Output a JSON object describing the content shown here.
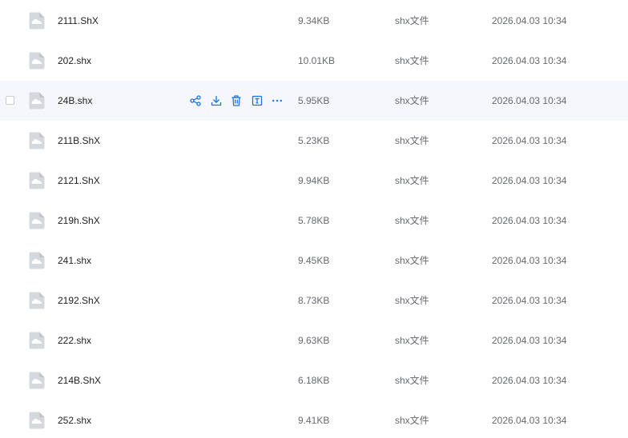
{
  "colors": {
    "accent": "#1a73e8",
    "hover_row": "#f5f7fa",
    "icon_gray": "#d5d8dd"
  },
  "hover_actions": [
    {
      "icon": "share-icon"
    },
    {
      "icon": "download-icon"
    },
    {
      "icon": "delete-icon"
    },
    {
      "icon": "rename-icon"
    },
    {
      "icon": "more-icon"
    }
  ],
  "files": [
    {
      "name": "2111.ShX",
      "size": "9.34KB",
      "type": "shx文件",
      "modified": "2026.04.03 10:34"
    },
    {
      "name": "202.shx",
      "size": "10.01KB",
      "type": "shx文件",
      "modified": "2026.04.03 10:34"
    },
    {
      "name": "24B.shx",
      "size": "5.95KB",
      "type": "shx文件",
      "modified": "2026.04.03 10:34"
    },
    {
      "name": "211B.ShX",
      "size": "5.23KB",
      "type": "shx文件",
      "modified": "2026.04.03 10:34"
    },
    {
      "name": "2121.ShX",
      "size": "9.94KB",
      "type": "shx文件",
      "modified": "2026.04.03 10:34"
    },
    {
      "name": "219h.ShX",
      "size": "5.78KB",
      "type": "shx文件",
      "modified": "2026.04.03 10:34"
    },
    {
      "name": "241.shx",
      "size": "9.45KB",
      "type": "shx文件",
      "modified": "2026.04.03 10:34"
    },
    {
      "name": "2192.ShX",
      "size": "8.73KB",
      "type": "shx文件",
      "modified": "2026.04.03 10:34"
    },
    {
      "name": "222.shx",
      "size": "9.63KB",
      "type": "shx文件",
      "modified": "2026.04.03 10:34"
    },
    {
      "name": "214B.ShX",
      "size": "6.18KB",
      "type": "shx文件",
      "modified": "2026.04.03 10:34"
    },
    {
      "name": "252.shx",
      "size": "9.41KB",
      "type": "shx文件",
      "modified": "2026.04.03 10:34"
    }
  ]
}
